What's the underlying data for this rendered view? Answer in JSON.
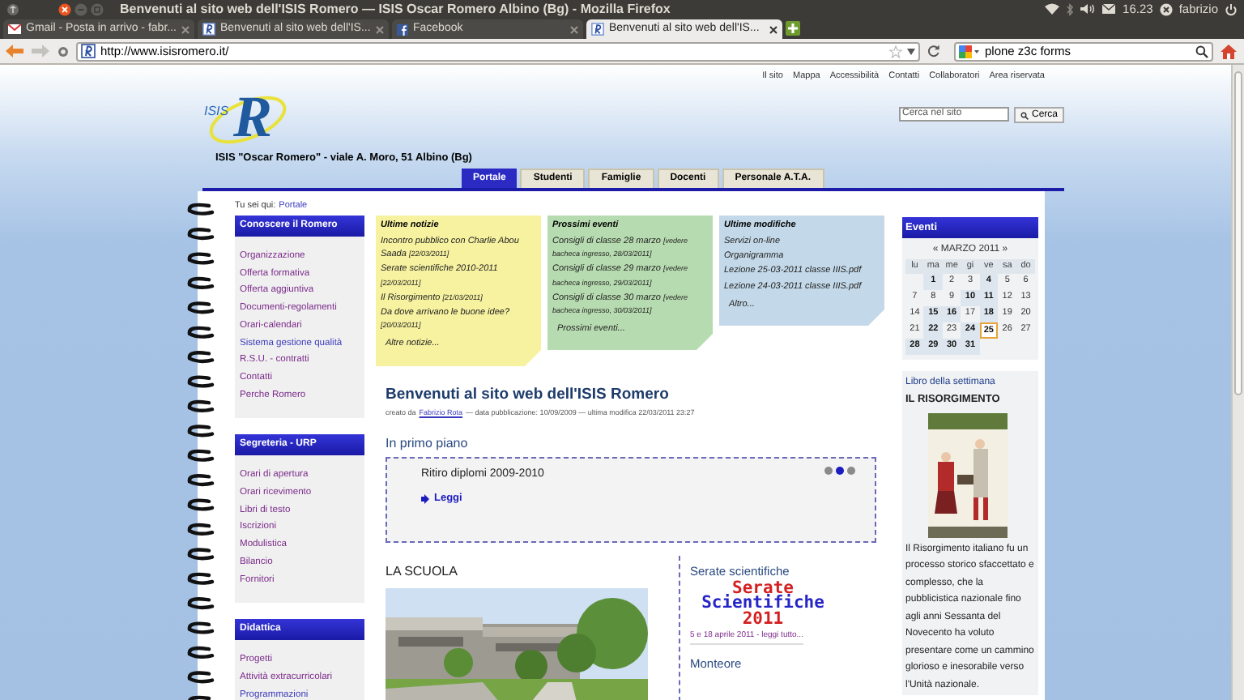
{
  "window": {
    "title": "Benvenuti al sito web dell'ISIS Romero — ISIS Oscar Romero Albino (Bg) - Mozilla Firefox"
  },
  "system_tray": {
    "clock": "16.23",
    "user": "fabrizio"
  },
  "browser_tabs": [
    {
      "label": "Gmail - Posta in arrivo - fabr...",
      "kind": "mail",
      "selected": false
    },
    {
      "label": "Benvenuti al sito web dell'IS...",
      "kind": "site",
      "selected": false
    },
    {
      "label": "Facebook",
      "kind": "facebook",
      "selected": false
    },
    {
      "label": "Benvenuti al sito web dell'IS...",
      "kind": "site",
      "selected": true
    }
  ],
  "toolbar": {
    "url": "http://www.isisromero.it/",
    "search_value": "plone z3c forms"
  },
  "site": {
    "top_links": [
      "Il sito",
      "Mappa",
      "Accessibilità",
      "Contatti",
      "Collaboratori",
      "Area riservata"
    ],
    "search": {
      "placeholder": "Cerca nel sito",
      "button": "Cerca"
    },
    "logo": {
      "small": "ISIS",
      "big": "R"
    },
    "address": "ISIS \"Oscar Romero\" - viale A. Moro, 51 Albino (Bg)",
    "tabs": [
      {
        "label": "Portale",
        "selected": true
      },
      {
        "label": "Studenti",
        "selected": false
      },
      {
        "label": "Famiglie",
        "selected": false
      },
      {
        "label": "Docenti",
        "selected": false
      },
      {
        "label": "Personale A.T.A.",
        "selected": false
      }
    ],
    "breadcrumb": {
      "label": "Tu sei qui:",
      "current": "Portale"
    },
    "portlets": [
      {
        "title": "Conoscere il Romero",
        "items": [
          {
            "label": "Organizzazione",
            "visited": true
          },
          {
            "label": "Offerta formativa",
            "visited": true
          },
          {
            "label": "Offerta aggiuntiva",
            "visited": true
          },
          {
            "label": "Documenti-regolamenti",
            "visited": true
          },
          {
            "label": "Orari-calendari",
            "visited": true
          },
          {
            "label": "Sistema gestione qualità",
            "visited": false
          },
          {
            "label": "R.S.U. - contratti",
            "visited": true
          },
          {
            "label": "Contatti",
            "visited": true
          },
          {
            "label": "Perche Romero",
            "visited": true
          }
        ]
      },
      {
        "title": "Segreteria - URP",
        "items": [
          {
            "label": "Orari di apertura",
            "visited": true
          },
          {
            "label": "Orari ricevimento",
            "visited": true
          },
          {
            "label": "Libri di testo",
            "visited": true
          },
          {
            "label": "Iscrizioni",
            "visited": true
          },
          {
            "label": "Modulistica",
            "visited": true
          },
          {
            "label": "Bilancio",
            "visited": true
          },
          {
            "label": "Fornitori",
            "visited": true
          }
        ]
      },
      {
        "title": "Didattica",
        "items": [
          {
            "label": "Progetti",
            "visited": true
          },
          {
            "label": "Attività extracurricolari",
            "visited": true
          },
          {
            "label": "Programmazioni",
            "visited": false
          }
        ]
      }
    ],
    "notes": [
      {
        "title": "Ultime notizie",
        "color": "#f7f2a0",
        "items": [
          {
            "text": "Incontro pubblico con Charlie Abou Saada",
            "date": "[22/03/2011]"
          },
          {
            "text": "Serate scientifiche 2010-2011",
            "date": "[22/03/2011]"
          },
          {
            "text": "Il Risorgimento",
            "date": "[21/03/2011]"
          },
          {
            "text": "Da dove arrivano le buone idee?",
            "date": "[20/03/2011]"
          }
        ],
        "more": "Altre notizie..."
      },
      {
        "title": "Prossimi eventi",
        "color": "#b7dbb0",
        "items": [
          {
            "text": "Consigli di classe 28 marzo",
            "date": "[vedere bacheca ingresso, 28/03/2011]"
          },
          {
            "text": "Consigli di classe 29 marzo",
            "date": "[vedere bacheca ingresso, 29/03/2011]"
          },
          {
            "text": "Consigli di classe 30 marzo",
            "date": "[vedere bacheca ingresso, 30/03/2011]"
          }
        ],
        "more": "Prossimi eventi..."
      },
      {
        "title": "Ultime modifiche",
        "color": "#c3d8e8",
        "items": [
          {
            "text": "Servizi on-line"
          },
          {
            "text": "Organigramma"
          },
          {
            "text": "Lezione 25-03-2011 classe IIIS.pdf"
          },
          {
            "text": "Lezione 24-03-2011 classe IIIS.pdf"
          }
        ],
        "more": "Altro..."
      }
    ],
    "article": {
      "title": "Benvenuti al sito web dell'ISIS Romero",
      "byline_prefix": "creato da",
      "author": "Fabrizio Rota",
      "byline_rest": "— data pubblicazione: 10/09/2009 — ultima modifica 22/03/2011 23:27"
    },
    "featured": {
      "heading": "In primo piano",
      "title": "Ritiro diplomi 2009-2010",
      "link": "Leggi",
      "dots": [
        {
          "selected": false
        },
        {
          "selected": true
        },
        {
          "selected": false
        }
      ]
    },
    "school": {
      "heading": "LA SCUOLA"
    },
    "serate": {
      "heading": "Serate scientifiche",
      "banner": [
        {
          "text": "Serate",
          "color": "#d42020"
        },
        {
          "text": "Scientifiche",
          "color": "#2424c8"
        },
        {
          "text": "2011",
          "color": "#d42020"
        }
      ],
      "link": "5 e 18 aprile 2011 - leggi tutto...",
      "next_heading": "Monteore"
    },
    "calendar": {
      "title": "Eventi",
      "month": "« MARZO 2011 »",
      "weekdays": [
        "lu",
        "ma",
        "me",
        "gi",
        "ve",
        "sa",
        "do"
      ],
      "weeks": [
        [
          {
            "kind": "blank"
          },
          {
            "kind": "day",
            "day": "1",
            "events": true,
            "today": false
          },
          {
            "kind": "day",
            "day": "2",
            "events": false,
            "today": false
          },
          {
            "kind": "day",
            "day": "3",
            "events": false,
            "today": false
          },
          {
            "kind": "day",
            "day": "4",
            "events": true,
            "today": false
          },
          {
            "kind": "day",
            "day": "5",
            "events": false,
            "today": false
          },
          {
            "kind": "day",
            "day": "6",
            "events": false,
            "today": false
          }
        ],
        [
          {
            "kind": "day",
            "day": "7",
            "events": false,
            "today": false
          },
          {
            "kind": "day",
            "day": "8",
            "events": false,
            "today": false
          },
          {
            "kind": "day",
            "day": "9",
            "events": false,
            "today": false
          },
          {
            "kind": "day",
            "day": "10",
            "events": true,
            "today": false
          },
          {
            "kind": "day",
            "day": "11",
            "events": true,
            "today": false
          },
          {
            "kind": "day",
            "day": "12",
            "events": false,
            "today": false
          },
          {
            "kind": "day",
            "day": "13",
            "events": false,
            "today": false
          }
        ],
        [
          {
            "kind": "day",
            "day": "14",
            "events": false,
            "today": false
          },
          {
            "kind": "day",
            "day": "15",
            "events": true,
            "today": false
          },
          {
            "kind": "day",
            "day": "16",
            "events": true,
            "today": false
          },
          {
            "kind": "day",
            "day": "17",
            "events": false,
            "today": false
          },
          {
            "kind": "day",
            "day": "18",
            "events": true,
            "today": false
          },
          {
            "kind": "day",
            "day": "19",
            "events": false,
            "today": false
          },
          {
            "kind": "day",
            "day": "20",
            "events": false,
            "today": false
          }
        ],
        [
          {
            "kind": "day",
            "day": "21",
            "events": false,
            "today": false
          },
          {
            "kind": "day",
            "day": "22",
            "events": true,
            "today": false
          },
          {
            "kind": "day",
            "day": "23",
            "events": false,
            "today": false
          },
          {
            "kind": "day",
            "day": "24",
            "events": true,
            "today": false
          },
          {
            "kind": "day",
            "day": "25",
            "events": true,
            "today": true
          },
          {
            "kind": "day",
            "day": "26",
            "events": false,
            "today": false
          },
          {
            "kind": "day",
            "day": "27",
            "events": false,
            "today": false
          }
        ],
        [
          {
            "kind": "day",
            "day": "28",
            "events": true,
            "today": false
          },
          {
            "kind": "day",
            "day": "29",
            "events": true,
            "today": false
          },
          {
            "kind": "day",
            "day": "30",
            "events": true,
            "today": false
          },
          {
            "kind": "day",
            "day": "31",
            "events": true,
            "today": false
          }
        ]
      ]
    },
    "book": {
      "label": "Libro della settimana",
      "title": "IL RISORGIMENTO",
      "description": "Il Risorgimento italiano fu un processo storico sfaccettato e complesso, che la pubblicistica nazionale fino agli anni Sessanta del Novecento ha voluto presentare come un cammino glorioso e inesorabile verso l'Unità nazionale."
    }
  }
}
